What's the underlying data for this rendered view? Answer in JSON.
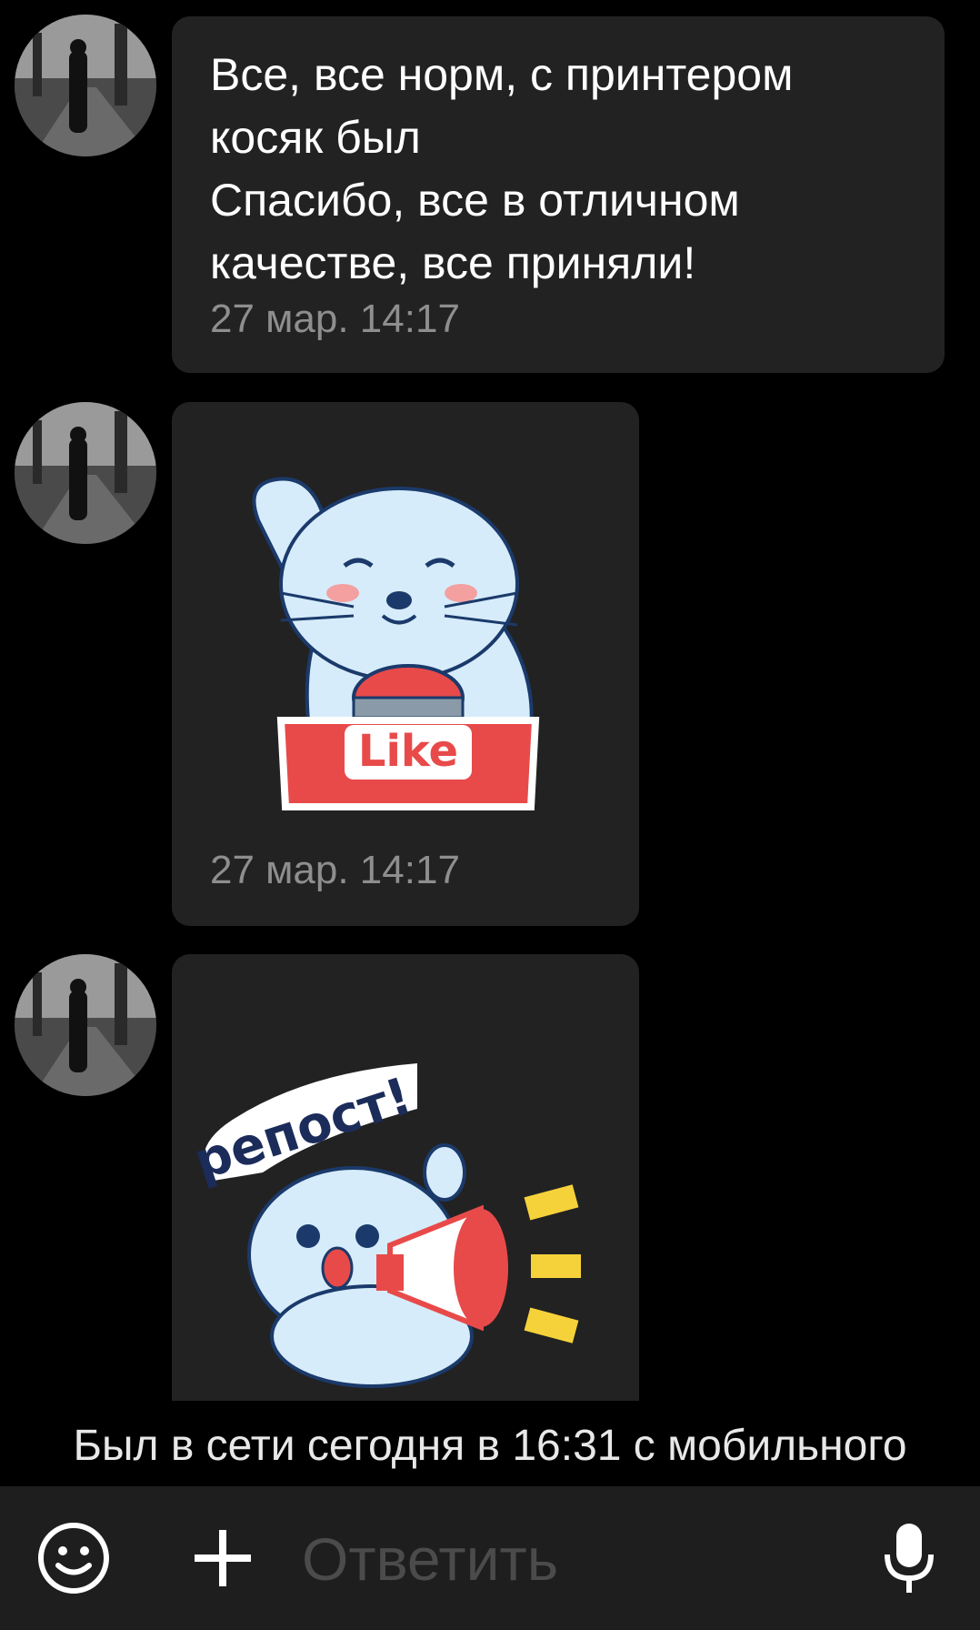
{
  "messages": [
    {
      "type": "text",
      "text": "Все, все норм, с принтером\nкосяк был\nСпасибо, все в отличном\nкачестве, все приняли!",
      "time": "27 мар. 14:17"
    },
    {
      "type": "sticker",
      "sticker": "cat-like-sticker",
      "sticker_text": "Like",
      "time": "27 мар. 14:17"
    },
    {
      "type": "sticker",
      "sticker": "cat-repost-megaphone-sticker",
      "sticker_text": "репост!"
    }
  ],
  "status": {
    "last_seen": "Был в сети сегодня в 16:31 с мобильного"
  },
  "composer": {
    "placeholder": "Ответить",
    "icons": [
      "smile-icon",
      "plus-icon",
      "microphone-icon"
    ]
  },
  "colors": {
    "bubble": "#222222",
    "timestamp": "#8e8e8e",
    "sticker_red": "#e84a4a",
    "cat_blue": "#d6ecfa"
  }
}
